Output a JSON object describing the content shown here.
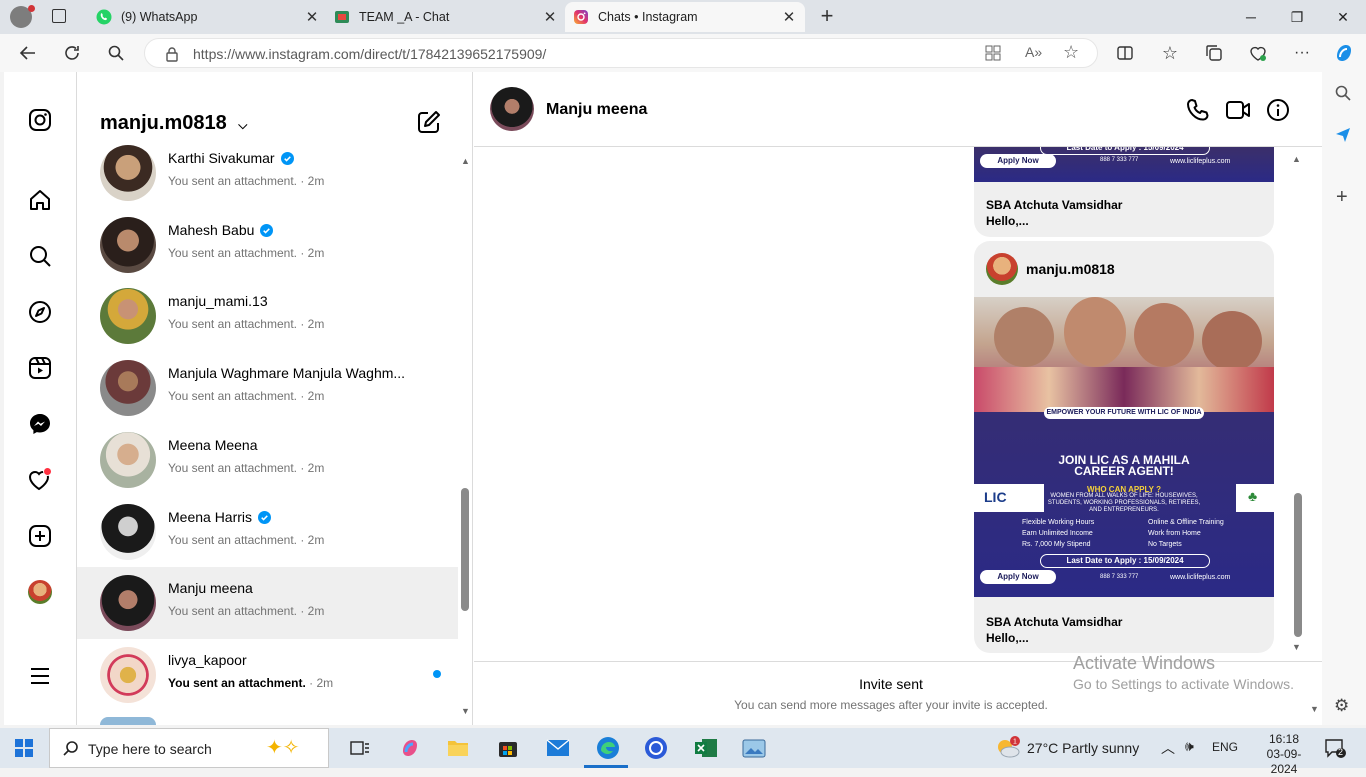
{
  "browser": {
    "tabs": [
      {
        "title": "(9) WhatsApp",
        "icon": "whatsapp-icon"
      },
      {
        "title": "TEAM _A - Chat",
        "icon": "chat-icon"
      },
      {
        "title": "Chats • Instagram",
        "icon": "instagram-icon"
      }
    ],
    "url": "https://www.instagram.com/direct/t/17842139652175909/"
  },
  "inbox": {
    "username": "manju.m0818",
    "conversations": [
      {
        "name": "Karthi Sivakumar",
        "verified": true,
        "preview": "You sent an attachment.",
        "time": " · 2m"
      },
      {
        "name": "Mahesh Babu",
        "verified": true,
        "preview": "You sent an attachment.",
        "time": " · 2m"
      },
      {
        "name": "manju_mami.13",
        "verified": false,
        "preview": "You sent an attachment.",
        "time": " · 2m"
      },
      {
        "name": "Manjula Waghmare Manjula Waghm...",
        "verified": false,
        "preview": "You sent an attachment.",
        "time": " · 2m"
      },
      {
        "name": "Meena Meena",
        "verified": false,
        "preview": "You sent an attachment.",
        "time": " · 2m"
      },
      {
        "name": "Meena Harris",
        "verified": true,
        "preview": "You sent an attachment.",
        "time": " · 2m"
      },
      {
        "name": "Manju meena",
        "verified": false,
        "preview": "You sent an attachment.",
        "time": " · 2m"
      },
      {
        "name": "livya_kapoor",
        "verified": false,
        "preview": "You sent an attachment.",
        "time": " · 2m",
        "unread": true
      }
    ]
  },
  "chat": {
    "contact": "Manju meena",
    "messages": [
      {
        "sender": "SBA Atchuta Vamsidhar",
        "text": "Hello,..."
      },
      {
        "header": "manju.m0818",
        "sender": "SBA Atchuta Vamsidhar",
        "text": "Hello,..."
      }
    ],
    "poster": {
      "tagline": "EMPOWER YOUR FUTURE WITH LIC OF INDIA",
      "headline1": "JOIN LIC AS A MAHILA",
      "headline2": "CAREER AGENT!",
      "who": "WHO CAN APPLY ?",
      "lic": "LIC",
      "eligibility": "WOMEN FROM ALL WALKS OF LIFE: HOUSEWIVES, STUDENTS, WORKING PROFESSIONALS, RETIREES, AND ENTREPRENEURS.",
      "features": [
        "Flexible Working Hours",
        "Earn Unlimited Income",
        "Rs. 7,000 Mly Stipend",
        "Online & Offline Training",
        "Work from Home",
        "No Targets"
      ],
      "last_date": "Last Date to Apply : 15/09/2024",
      "apply": "Apply Now",
      "phone": "888 7 333 777",
      "website": "www.liclifeplus.com"
    },
    "footer_title": "Invite sent",
    "footer_sub": "You can send more messages after your invite is accepted."
  },
  "watermark": {
    "line1": "Activate Windows",
    "line2": "Go to Settings to activate Windows."
  },
  "taskbar": {
    "search_placeholder": "Type here to search",
    "weather": "27°C  Partly sunny",
    "lang": "ENG",
    "time": "16:18",
    "date": "03-09-2024",
    "notifications": "2"
  }
}
